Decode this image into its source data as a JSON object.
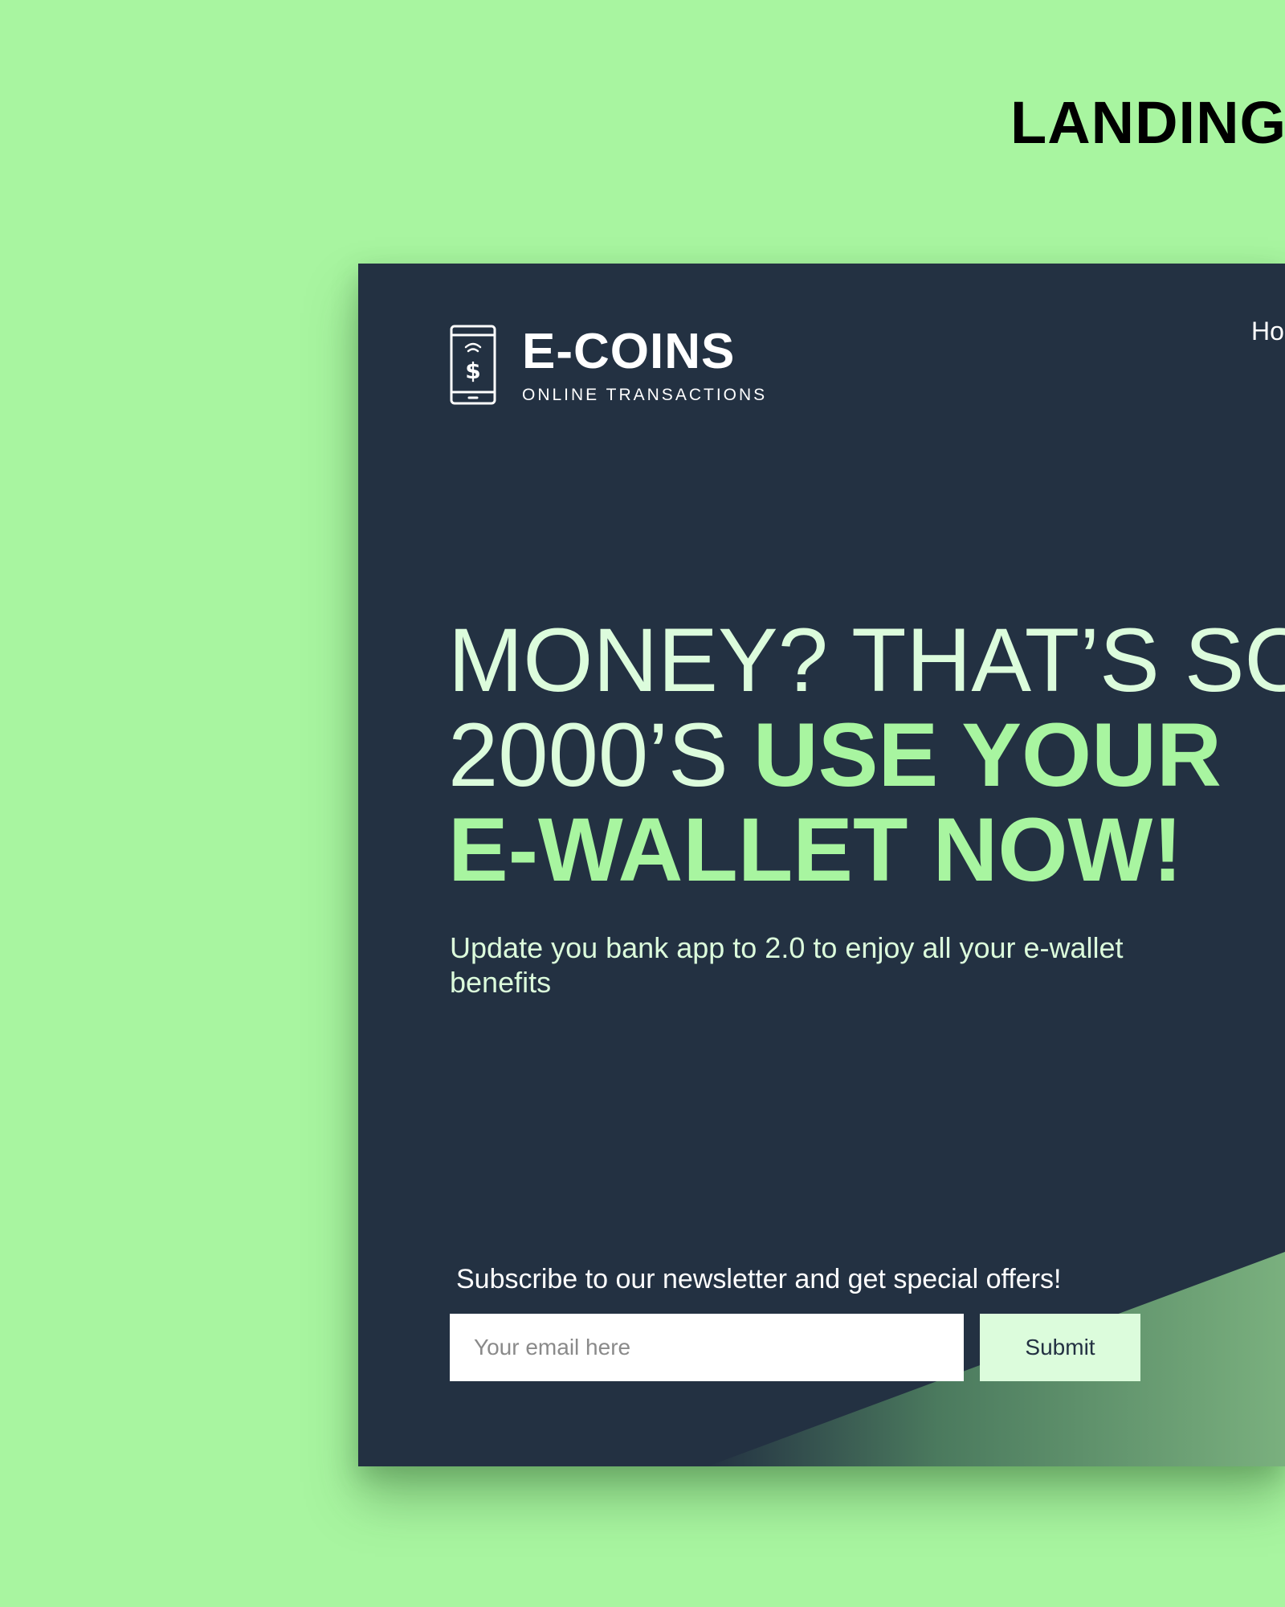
{
  "showcase": {
    "title": "LANDING"
  },
  "colors": {
    "page_background": "#a8f5a0",
    "card_background": "#233142",
    "accent_green": "#a8f5a0",
    "light_mint": "#dcfcdc"
  },
  "brand": {
    "icon": "phone-dollar-icon",
    "name": "E-COINS",
    "tagline": "ONLINE TRANSACTIONS"
  },
  "nav": {
    "items": [
      "Ho"
    ]
  },
  "hero": {
    "line1": "MONEY? THAT’S SO",
    "line2_light": "2000’S ",
    "line2_bold": "USE YOUR",
    "line3_bold": "E-WALLET NOW!",
    "subtext": "Update you bank app to 2.0 to enjoy all your e-wallet benefits"
  },
  "newsletter": {
    "label": "Subscribe to our newsletter and get special offers!",
    "email_placeholder": "Your email here",
    "submit_label": "Submit"
  }
}
